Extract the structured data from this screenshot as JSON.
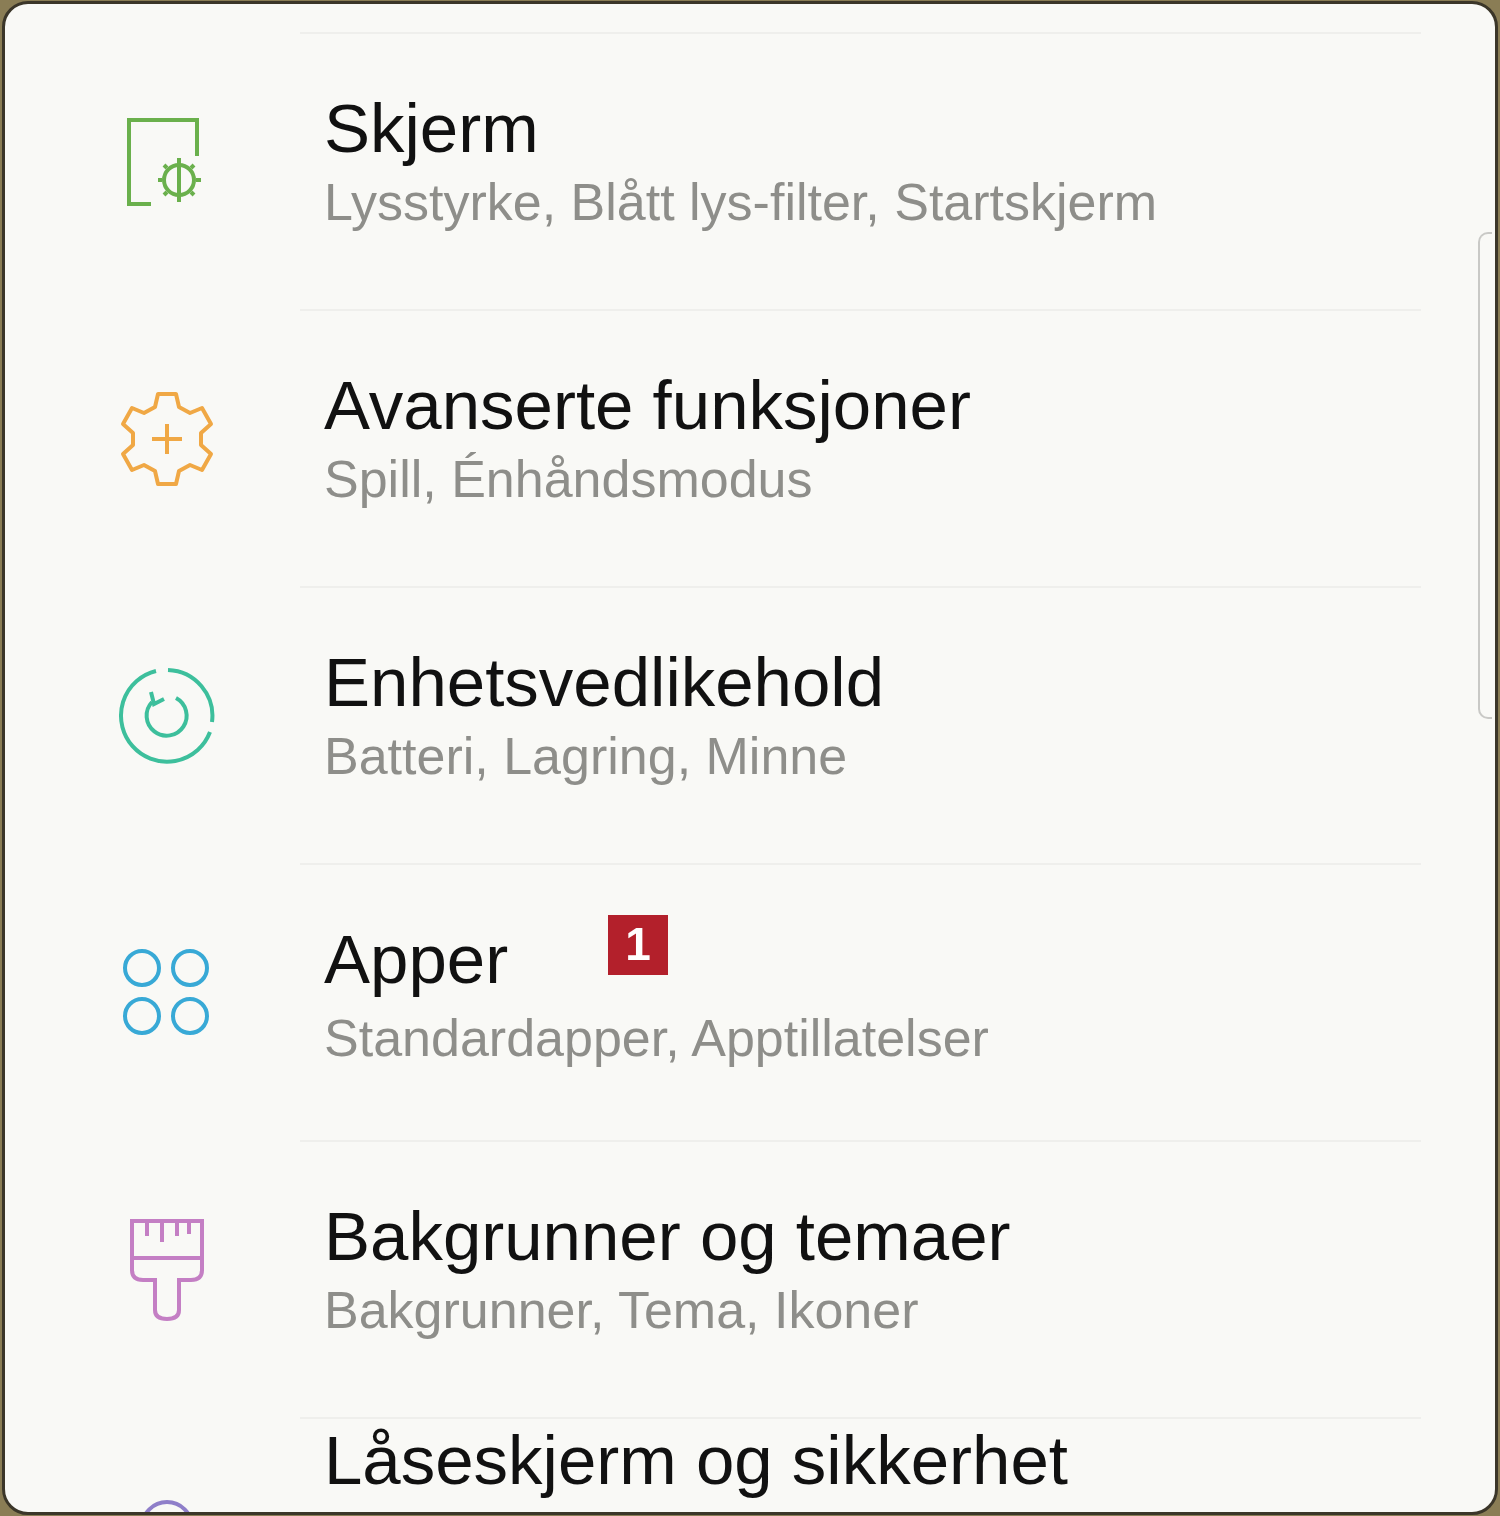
{
  "settings_items": [
    {
      "title": "Skjerm",
      "subtitle": "Lysstyrke, Blått lys-filter, Startskjerm",
      "color": "#6ab04c"
    },
    {
      "title": "Avanserte funksjoner",
      "subtitle": "Spill, Énhåndsmodus",
      "color": "#f0a845"
    },
    {
      "title": "Enhetsvedlikehold",
      "subtitle": "Batteri, Lagring, Minne",
      "color": "#3dbf9c"
    },
    {
      "title": "Apper",
      "subtitle": "Standardapper, Apptillatelser",
      "color": "#38a9d6",
      "badge": "1"
    },
    {
      "title": "Bakgrunner og temaer",
      "subtitle": "Bakgrunner, Tema, Ikoner",
      "color": "#c47fc4"
    },
    {
      "title": "Låseskjerm og sikkerhet",
      "color": "#8f7fc9"
    }
  ]
}
